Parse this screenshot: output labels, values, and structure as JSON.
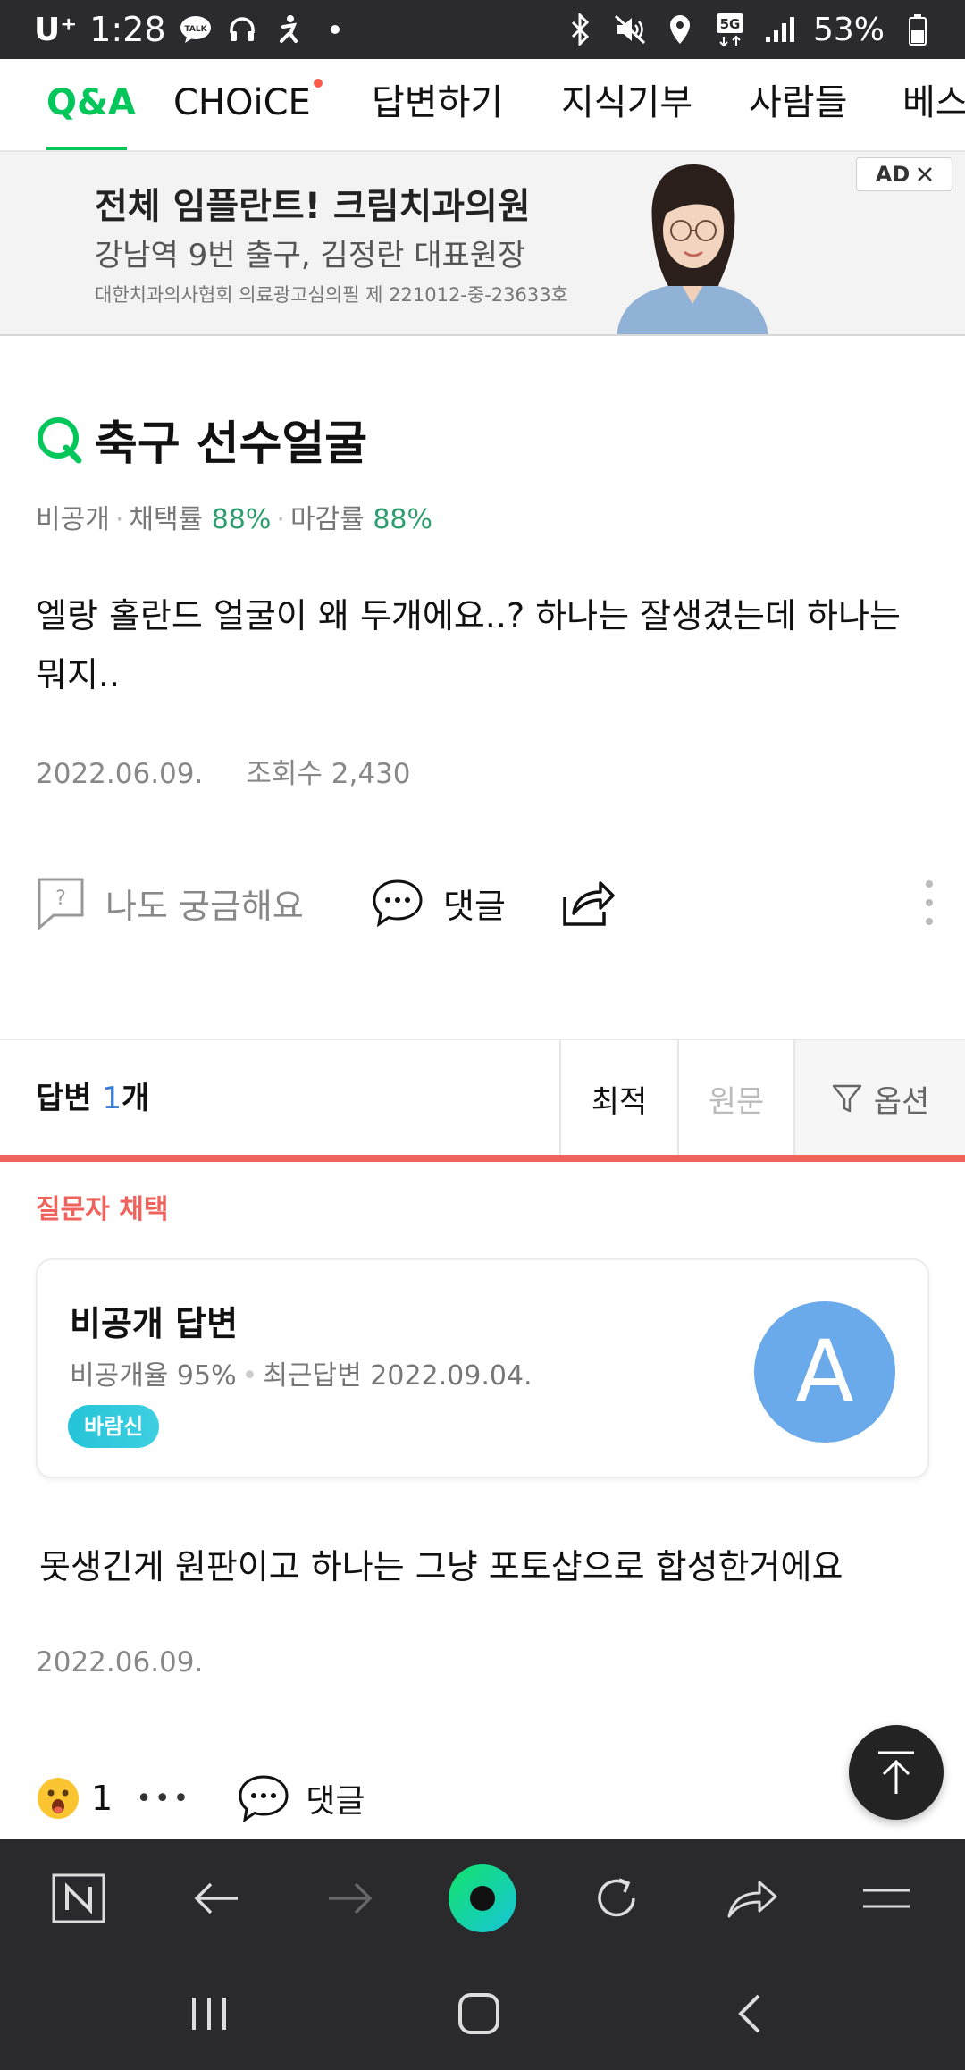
{
  "status_bar": {
    "carrier": "U⁺",
    "time": "1:28",
    "battery": "53%"
  },
  "nav": {
    "tabs": [
      {
        "label": "Q&A",
        "active": true
      },
      {
        "label": "CHOiCE",
        "active": false,
        "has_new_dot": true
      },
      {
        "label": "답변하기",
        "active": false
      },
      {
        "label": "지식기부",
        "active": false
      },
      {
        "label": "사람들",
        "active": false
      },
      {
        "label": "베스",
        "active": false
      }
    ]
  },
  "ad": {
    "title": "전체 임플란트! 크림치과의원",
    "subtitle": "강남역 9번 출구, 김정란 대표원장",
    "note": "대한치과의사협회 의료광고심의필 제 221012-중-23633호",
    "badge": "AD"
  },
  "question": {
    "title": "축구 선수얼굴",
    "meta_private": "비공개",
    "meta_adopt_label": "채택률",
    "meta_adopt_value": "88%",
    "meta_close_label": "마감률",
    "meta_close_value": "88%",
    "body": "엘랑 홀란드 얼굴이 왜 두개에요..? 하나는 잘생겼는데 하나는 뭐지..",
    "date": "2022.06.09.",
    "views": "조회수 2,430",
    "me_too_label": "나도 궁금해요",
    "comment_label": "댓글"
  },
  "answers": {
    "count_prefix": "답변",
    "count_num": "1",
    "count_suffix": "개",
    "sort_best": "최적",
    "sort_original": "원문",
    "option_label": "옵션",
    "chosen_label": "질문자 채택",
    "items": [
      {
        "name": "비공개 답변",
        "private_rate": "비공개율 95%",
        "recent": "최근답변 2022.09.04.",
        "badge": "바람신",
        "avatar_letter": "A",
        "body": "못생긴게 원판이고 하나는 그냥 포토샵으로 합성한거에요",
        "date": "2022.06.09.",
        "reaction_count": "1",
        "more": "•••",
        "comment_label": "댓글"
      }
    ]
  },
  "colors": {
    "brand_green": "#03c75a",
    "accent_red": "#f0625c",
    "avatar_blue": "#6aa9ea",
    "bar_dark": "#2a2a2c"
  },
  "icons": {
    "q_mark": "q-logo-icon",
    "browser": [
      "naver-n-icon",
      "back-arrow-icon",
      "forward-arrow-icon",
      "naver-green-dot-icon",
      "refresh-icon",
      "share-icon",
      "menu-icon"
    ],
    "system": [
      "recents-icon",
      "home-icon",
      "back-icon"
    ]
  }
}
